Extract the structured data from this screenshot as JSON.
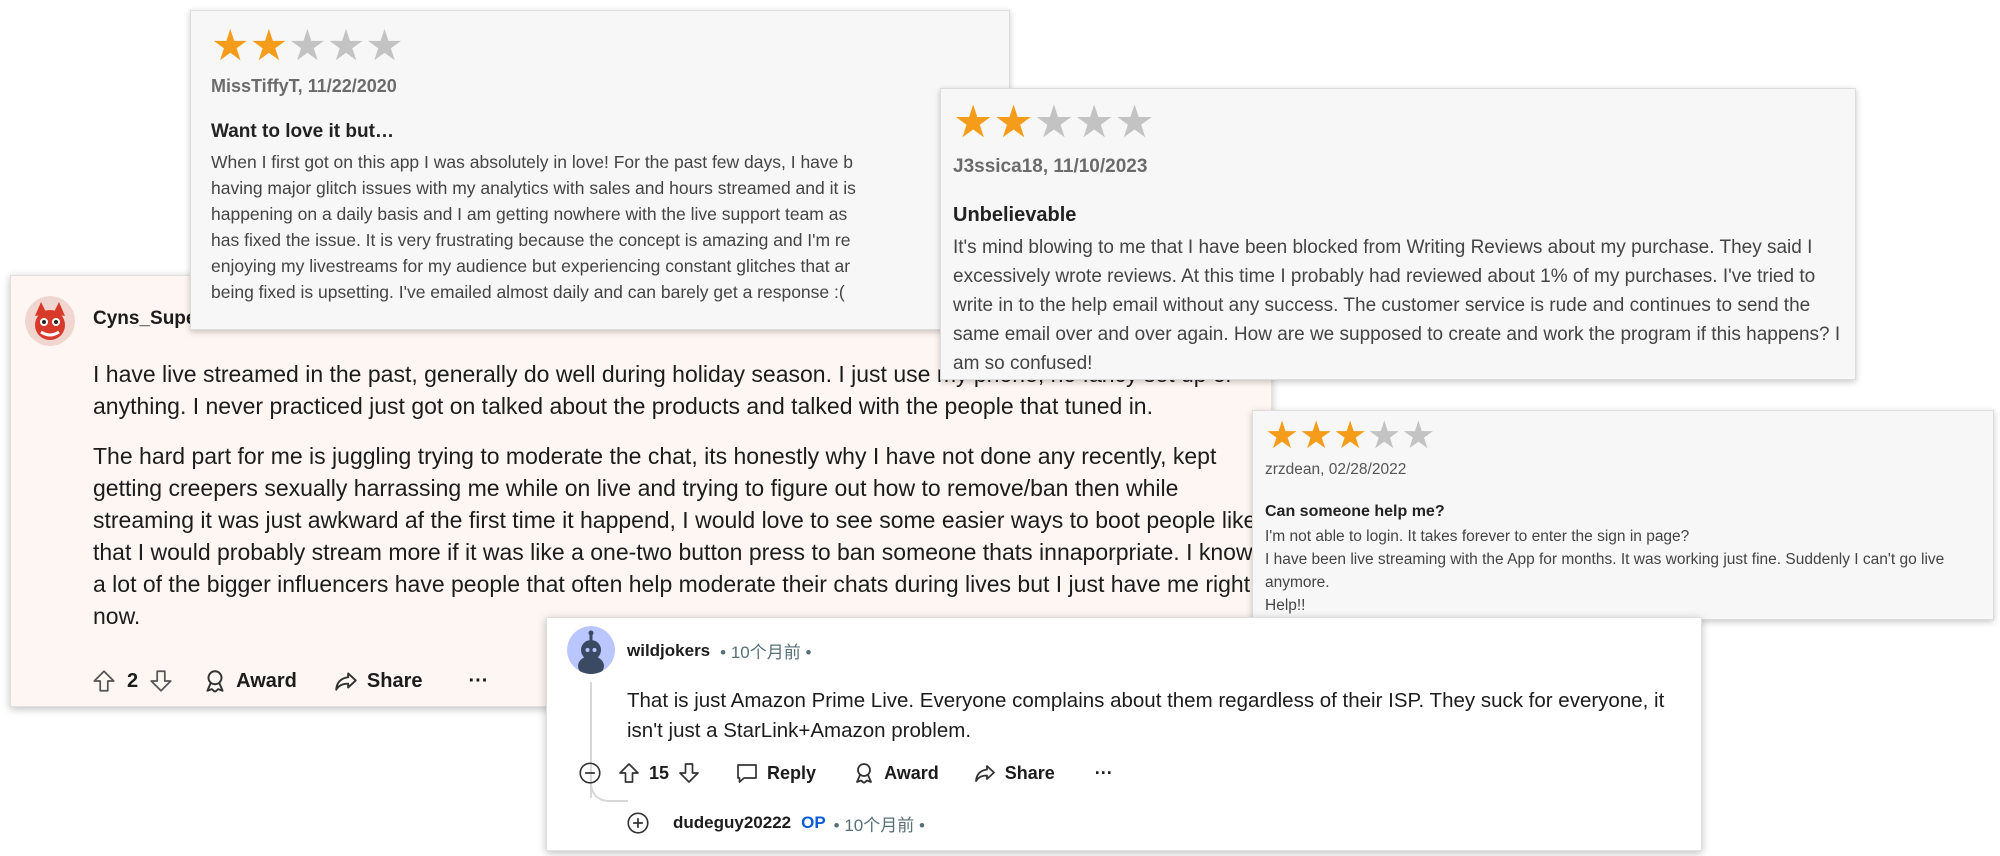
{
  "review_a": {
    "rating": 2,
    "max_rating": 5,
    "author_date": "MissTiffyT, 11/22/2020",
    "title": "Want to love it but…",
    "lines": [
      "When I first got on this app I was absolutely in love! For the past few days, I have b",
      "having major glitch issues with my analytics with sales and hours streamed and it is",
      "happening on a daily basis and I am getting nowhere with the live support team as",
      "has fixed the issue. It is very frustrating because the concept is amazing and I'm re",
      "enjoying my livestreams for my audience but experiencing constant glitches that ar",
      "being fixed is upsetting. I've emailed almost daily and can barely get a response :("
    ]
  },
  "review_b": {
    "rating": 2,
    "max_rating": 5,
    "author_date": "J3ssica18, 11/10/2023",
    "title": "Unbelievable",
    "body": "It's mind blowing to me that I have been blocked from Writing Reviews about my purchase. They said I excessively wrote reviews. At this time I probably had reviewed about 1% of my purchases. I've tried to write in to the help email without any success. The customer service is rude and continues to send the same email over and over again. How are we supposed to create and work the program if this happens? I am so confused!"
  },
  "review_c": {
    "rating": 3,
    "max_rating": 5,
    "author_date": "zrzdean, 02/28/2022",
    "title": "Can someone help me?",
    "lines": [
      "I'm not able to login. It takes forever to enter the sign in page?",
      "I have been live streaming with the App for months. It was working just fine. Suddenly I can't go live anymore.",
      "Help!!"
    ]
  },
  "comment_a": {
    "username": "Cyns_Supe",
    "paragraphs": [
      "I have live streamed in the past, generally do well during holiday season. I just use my phone, no fancy set up or anything. I never practiced just got on talked about the products and talked with the people that tuned in.",
      "The hard part for me is juggling trying to moderate the chat, its honestly why I have not done any recently, kept getting creepers sexually harrassing me while on live and trying to figure out how to remove/ban then while streaming it was just awkward af the first time it happend, I would love to see some easier ways to boot people like that I would probably stream more if it was like a one-two button press to ban someone thats innaporpriate. I know a lot of the bigger influencers have people that often help moderate their chats during lives but I just have me right now."
    ],
    "votes": "2",
    "award_label": "Award",
    "share_label": "Share",
    "more_label": "···"
  },
  "comment_b": {
    "username": "wildjokers",
    "meta": "• 10个月前 •",
    "body": "That is just Amazon Prime Live. Everyone complains about them regardless of their ISP. They suck for everyone, it isn't just a StarLink+Amazon problem.",
    "votes": "15",
    "reply_label": "Reply",
    "award_label": "Award",
    "share_label": "Share",
    "more_label": "···",
    "reply_user": "dudeguy20222",
    "reply_op": "OP",
    "reply_meta": "• 10个月前 •"
  },
  "colors": {
    "star_on": "#f59c1a",
    "star_off": "#c3c3c3",
    "op_blue": "#0a5bd6",
    "comment_a_bg": "#fdf6f2"
  }
}
